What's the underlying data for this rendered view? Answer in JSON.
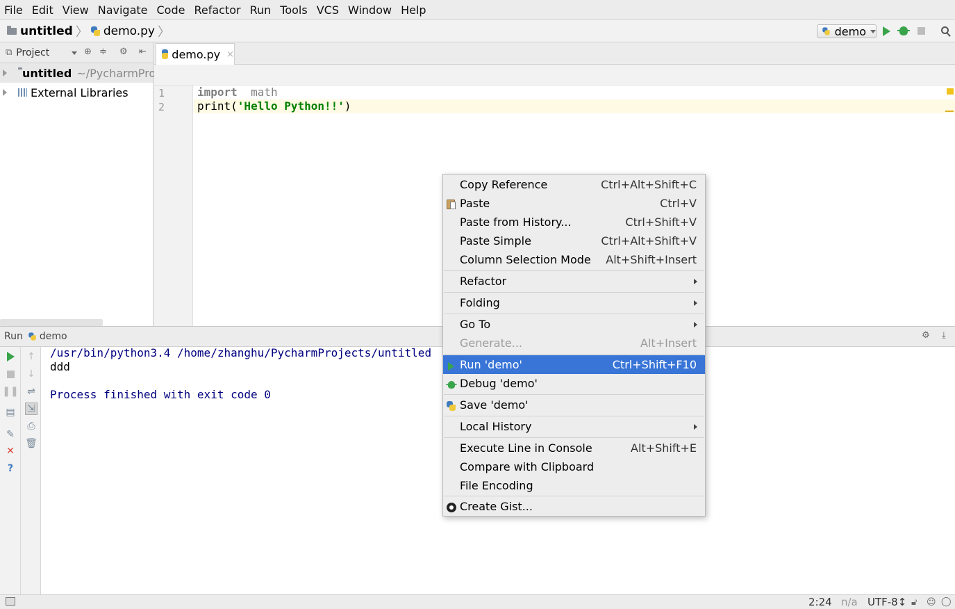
{
  "menubar": {
    "items": [
      "File",
      "Edit",
      "View",
      "Navigate",
      "Code",
      "Refactor",
      "Run",
      "Tools",
      "VCS",
      "Window",
      "Help"
    ]
  },
  "navbar": {
    "project": "untitled",
    "file": "demo.py",
    "run_config": "demo"
  },
  "project_panel": {
    "title": "Project",
    "tree": [
      {
        "label": "untitled",
        "path": "~/PycharmPro"
      },
      {
        "label": "External Libraries"
      }
    ]
  },
  "editor": {
    "tab": "demo.py",
    "tab_close": "×",
    "line_numbers": [
      "1",
      "2"
    ],
    "lines": [
      {
        "kw": "import",
        "rest": "math"
      },
      {
        "func": "print(",
        "str": "'Hello Python!!'",
        "end": ")"
      }
    ]
  },
  "run_panel": {
    "title": "Run",
    "config": "demo",
    "console": [
      "/usr/bin/python3.4 /home/zhanghu/PycharmProjects/untitled",
      "ddd",
      "",
      "Process finished with exit code 0"
    ]
  },
  "statusbar": {
    "position": "2:24",
    "na": "n/a",
    "encoding": "UTF-8↕"
  },
  "context_menu": {
    "items": [
      {
        "label": "Copy Reference",
        "shortcut": "Ctrl+Alt+Shift+C"
      },
      {
        "label": "Paste",
        "shortcut": "Ctrl+V"
      },
      {
        "label": "Paste from History...",
        "shortcut": "Ctrl+Shift+V"
      },
      {
        "label": "Paste Simple",
        "shortcut": "Ctrl+Alt+Shift+V"
      },
      {
        "label": "Column Selection Mode",
        "shortcut": "Alt+Shift+Insert"
      },
      {
        "label": "Refactor"
      },
      {
        "label": "Folding"
      },
      {
        "label": "Go To"
      },
      {
        "label": "Generate...",
        "shortcut": "Alt+Insert"
      },
      {
        "label": "Run 'demo'",
        "shortcut": "Ctrl+Shift+F10"
      },
      {
        "label": "Debug 'demo'"
      },
      {
        "label": "Save 'demo'"
      },
      {
        "label": "Local History"
      },
      {
        "label": "Execute Line in Console",
        "shortcut": "Alt+Shift+E"
      },
      {
        "label": "Compare with Clipboard"
      },
      {
        "label": "File Encoding"
      },
      {
        "label": "Create Gist..."
      }
    ]
  },
  "colors": {
    "selection": "#3875d7",
    "keyword": "#000080",
    "string": "#008000",
    "run_green": "#3aa44a"
  }
}
